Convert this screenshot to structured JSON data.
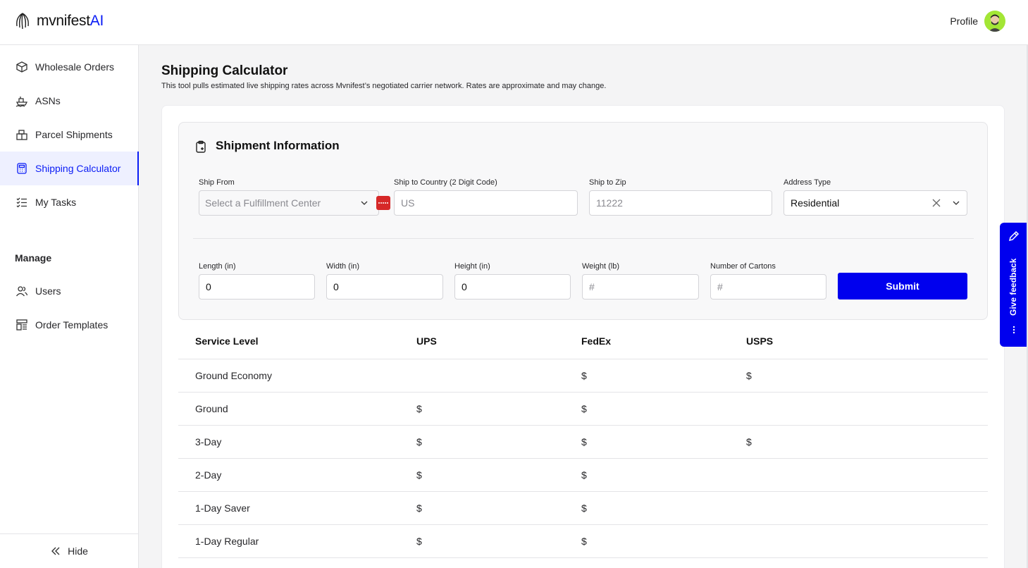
{
  "brand": {
    "name_main": "mvnifest",
    "name_accent": "AI",
    "accent_color": "#0a1cf5"
  },
  "header": {
    "profile_label": "Profile"
  },
  "sidebar": {
    "items": [
      {
        "label": "Wholesale Orders",
        "icon": "box-icon"
      },
      {
        "label": "ASNs",
        "icon": "ship-icon"
      },
      {
        "label": "Parcel Shipments",
        "icon": "parcel-icon"
      },
      {
        "label": "Shipping Calculator",
        "icon": "calculator-icon",
        "active": true
      },
      {
        "label": "My Tasks",
        "icon": "tasks-icon"
      }
    ],
    "manage_label": "Manage",
    "manage_items": [
      {
        "label": "Users",
        "icon": "users-icon"
      },
      {
        "label": "Order Templates",
        "icon": "templates-icon"
      }
    ],
    "hide_label": "Hide"
  },
  "page": {
    "title": "Shipping Calculator",
    "subtitle": "This tool pulls estimated live shipping rates across Mvnifest’s negotiated carrier network. Rates are approximate and may change."
  },
  "shipment": {
    "title": "Shipment Information",
    "ship_from": {
      "label": "Ship From",
      "placeholder": "Select a Fulfillment Center"
    },
    "ship_to_country": {
      "label": "Ship to Country (2 Digit Code)",
      "placeholder": "US"
    },
    "ship_to_zip": {
      "label": "Ship to Zip",
      "placeholder": "11222"
    },
    "address_type": {
      "label": "Address Type",
      "value": "Residential"
    },
    "length": {
      "label": "Length (in)",
      "value": "0"
    },
    "width": {
      "label": "Width (in)",
      "value": "0"
    },
    "height": {
      "label": "Height (in)",
      "value": "0"
    },
    "weight": {
      "label": "Weight (lb)",
      "placeholder": "#"
    },
    "cartons": {
      "label": "Number of Cartons",
      "placeholder": "#"
    },
    "submit_label": "Submit"
  },
  "rates": {
    "headers": [
      "Service Level",
      "UPS",
      "FedEx",
      "USPS"
    ],
    "rows": [
      [
        "Ground Economy",
        "",
        "$",
        "$"
      ],
      [
        "Ground",
        "$",
        "$",
        ""
      ],
      [
        "3-Day",
        "$",
        "$",
        "$"
      ],
      [
        "2-Day",
        "$",
        "$",
        ""
      ],
      [
        "1-Day Saver",
        "$",
        "$",
        ""
      ],
      [
        "1-Day Regular",
        "$",
        "$",
        ""
      ]
    ]
  },
  "feedback": {
    "label": "Give feedback"
  }
}
